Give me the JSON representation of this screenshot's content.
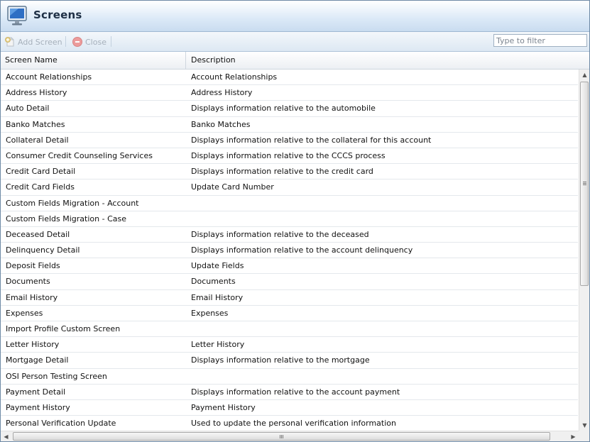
{
  "window": {
    "title": "Screens",
    "title_icon": "monitor-icon"
  },
  "toolbar": {
    "add_label": "Add Screen",
    "add_icon": "add-document-icon",
    "close_label": "Close",
    "close_icon": "close-circle-icon",
    "filter_placeholder": "Type to filter",
    "filter_value": ""
  },
  "grid": {
    "columns": [
      "Screen Name",
      "Description"
    ],
    "rows": [
      {
        "name": "Account Relationships",
        "description": "Account Relationships"
      },
      {
        "name": "Address History",
        "description": "Address History"
      },
      {
        "name": "Auto Detail",
        "description": "Displays information relative to the automobile"
      },
      {
        "name": "Banko Matches",
        "description": "Banko Matches"
      },
      {
        "name": "Collateral Detail",
        "description": "Displays information relative to the collateral for this account"
      },
      {
        "name": "Consumer Credit Counseling Services",
        "description": "Displays information relative to the CCCS process"
      },
      {
        "name": "Credit Card Detail",
        "description": "Displays information relative to the credit card"
      },
      {
        "name": "Credit Card Fields",
        "description": "Update Card Number"
      },
      {
        "name": "Custom Fields Migration - Account",
        "description": ""
      },
      {
        "name": "Custom Fields Migration - Case",
        "description": ""
      },
      {
        "name": "Deceased Detail",
        "description": "Displays information relative to the deceased"
      },
      {
        "name": "Delinquency Detail",
        "description": "Displays information relative to the account delinquency"
      },
      {
        "name": "Deposit Fields",
        "description": "Update Fields"
      },
      {
        "name": "Documents",
        "description": "Documents"
      },
      {
        "name": "Email History",
        "description": "Email History"
      },
      {
        "name": "Expenses",
        "description": "Expenses"
      },
      {
        "name": "Import Profile Custom Screen",
        "description": ""
      },
      {
        "name": "Letter History",
        "description": "Letter History"
      },
      {
        "name": "Mortgage Detail",
        "description": "Displays information relative to the mortgage"
      },
      {
        "name": "OSI Person Testing Screen",
        "description": ""
      },
      {
        "name": "Payment Detail",
        "description": "Displays information relative to the account payment"
      },
      {
        "name": "Payment History",
        "description": "Payment History"
      },
      {
        "name": "Personal Verification Update",
        "description": "Used to update the personal verification information"
      }
    ]
  },
  "colors": {
    "title_bar": "#dbe9f7",
    "toolbar": "#dde8f3",
    "disabled_text": "#a6b0bb",
    "row_divider": "#e4e8ec"
  }
}
